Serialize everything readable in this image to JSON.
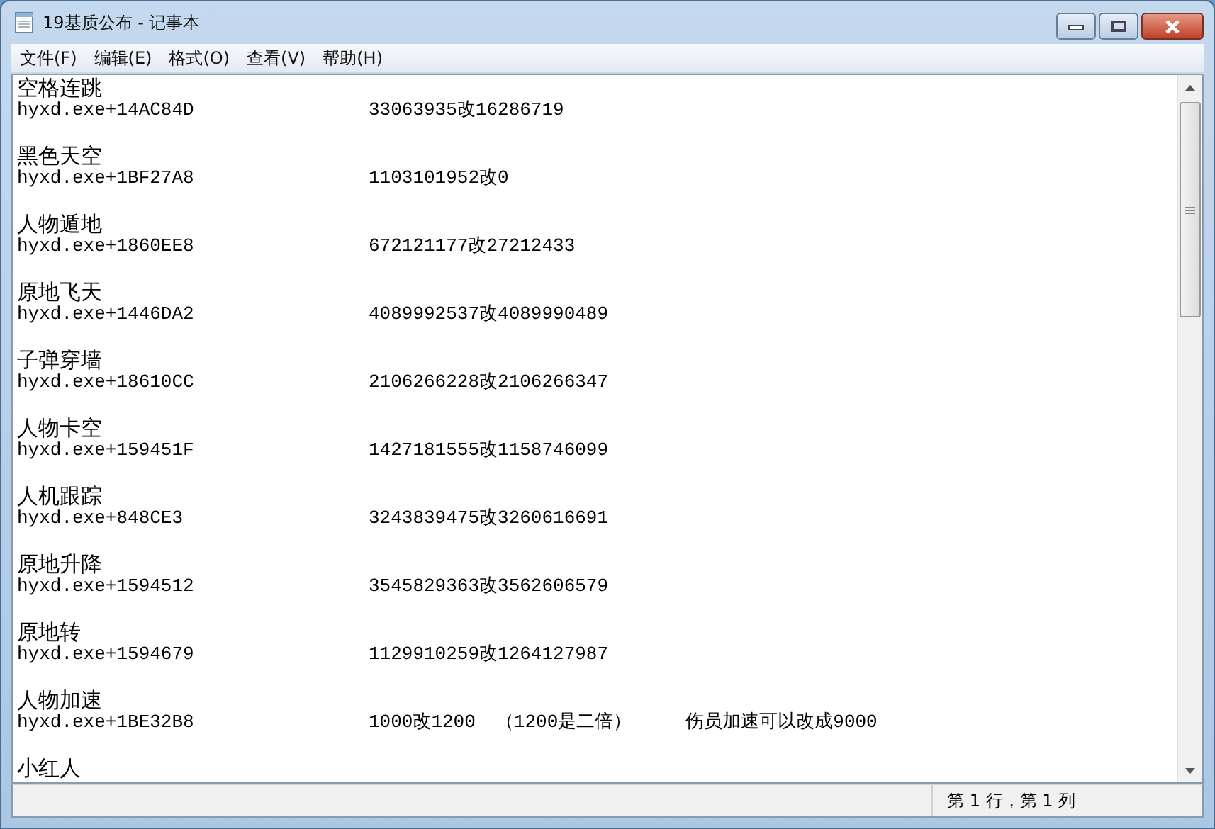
{
  "window": {
    "title": "19基质公布 - 记事本"
  },
  "menu": [
    {
      "label": "文件(F)"
    },
    {
      "label": "编辑(E)"
    },
    {
      "label": "格式(O)"
    },
    {
      "label": "查看(V)"
    },
    {
      "label": "帮助(H)"
    }
  ],
  "entries": [
    {
      "title": "空格连跳",
      "address": "hyxd.exe+14AC84D",
      "value": "33063935改16286719"
    },
    {
      "title": "黑色天空",
      "address": "hyxd.exe+1BF27A8",
      "value": "1103101952改0"
    },
    {
      "title": "人物遁地",
      "address": "hyxd.exe+1860EE8",
      "value": "672121177改27212433"
    },
    {
      "title": "原地飞天",
      "address": "hyxd.exe+1446DA2",
      "value": "4089992537改4089990489"
    },
    {
      "title": "子弹穿墙",
      "address": "hyxd.exe+18610CC",
      "value": "2106266228改2106266347"
    },
    {
      "title": "人物卡空",
      "address": "hyxd.exe+159451F",
      "value": "1427181555改1158746099"
    },
    {
      "title": "人机跟踪",
      "address": "hyxd.exe+848CE3",
      "value": "3243839475改3260616691"
    },
    {
      "title": "原地升降",
      "address": "hyxd.exe+1594512",
      "value": "3545829363改3562606579"
    },
    {
      "title": "原地转",
      "address": "hyxd.exe+1594679",
      "value": "1129910259改1264127987"
    },
    {
      "title": "人物加速",
      "address": "hyxd.exe+1BE32B8",
      "value": "1000改1200",
      "note": "（1200是二倍）",
      "remark": "伤员加速可以改成9000"
    },
    {
      "title": "小红人"
    }
  ],
  "status_bar": {
    "position": "第 1 行，第 1 列"
  }
}
